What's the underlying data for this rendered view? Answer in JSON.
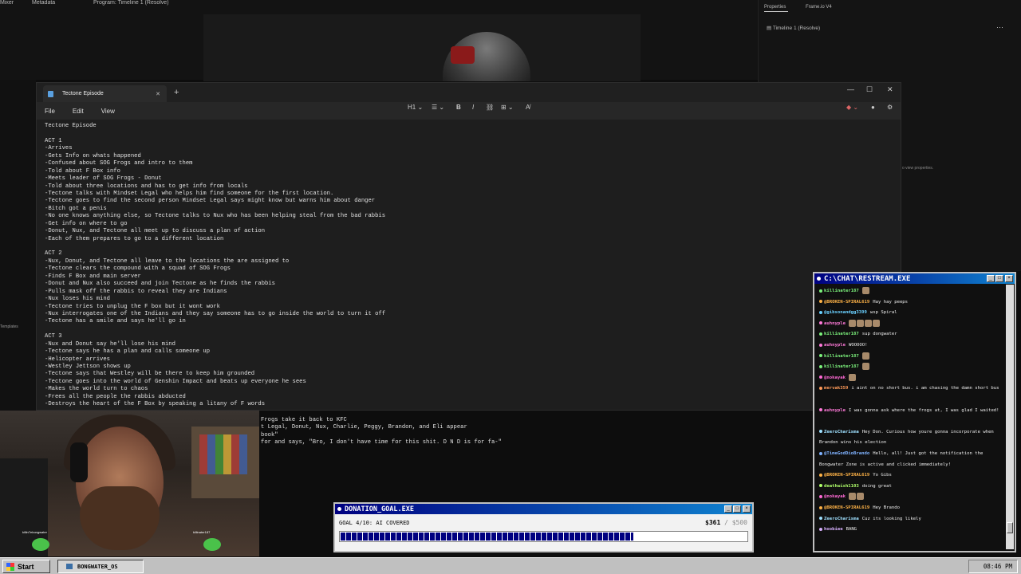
{
  "background_editor": {
    "tabs": [
      "Mixer",
      "Metadata",
      "Program: Timeline 1 (Resolve)"
    ],
    "right_panel_tabs": [
      "Properties",
      "Frame.io V4"
    ],
    "right_panel_item": "Timeline 1 (Resolve)",
    "hint": "o view properties.",
    "left_label": "Templates"
  },
  "notepad": {
    "tab_title": "Tectone Episode",
    "menu": [
      "File",
      "Edit",
      "View"
    ],
    "toolbar": [
      "H1",
      "list-icon",
      "bold-icon",
      "italic-icon",
      "link-icon",
      "table-icon",
      "clear-format-icon"
    ],
    "lines": [
      "Tectone Episode",
      "",
      "ACT 1",
      "-Arrives",
      "-Gets Info on whats happened",
      "-Confused about SOG Frogs and intro to them",
      "-Told about F Box info",
      "-Meets leader of SOG Frogs - Donut",
      "-Told about three locations and has to get info from locals",
      "-Tectone talks with Mindset Legal who helps him find someone for the first location.",
      "-Tectone goes to find the second person Mindset Legal says might know but warns him about danger",
      "-Bitch got a penis",
      "-No one knows anything else, so Tectone talks to Nux who has been helping steal from the bad rabbis",
      "-Get info on where to go",
      "-Donut, Nux, and Tectone all meet up to discuss a plan of action",
      "-Each of them prepares to go to a different location",
      "",
      "ACT 2",
      "-Nux, Donut, and Tectone all leave to the locations the are assigned to",
      "-Tectone clears the compound with a squad of SOG Frogs",
      "-Finds F Box and main server",
      "-Donut and Nux also succeed and join Tectone as he finds the rabbis",
      "-Pulls mask off the rabbis to reveal they are Indians",
      "-Nux loses his mind",
      "-Tectone tries to unplug the F box but it wont work",
      "-Nux interrogates one of the Indians and they say someone has to go inside the world to turn it off",
      "-Tectone has a smile and says he'll go in",
      "",
      "ACT 3",
      "-Nux and Donut say he'll lose his mind",
      "-Tectone says he has a plan and calls someone up",
      "-Helicopter arrives",
      "-Westley Jettson shows up",
      "-Tectone says that Westley will be there to keep him grounded",
      "-Tectone goes into the world of Genshin Impact and beats up everyone he sees",
      "-Makes the world turn to chaos",
      "-Frees all the people the rabbis abducted",
      "-Destroys the heart of the F Box by speaking a litany of F words"
    ],
    "continuation_lines": [
      "Frogs take it back to KFC",
      "t Legal, Donut, Nux, Charlie, Peggy, Brandon, and Eli appear",
      "book\"",
      "for and says, \"Bro, I don't have time for this shit. D N D is for fa-\""
    ]
  },
  "webcam": {
    "frog_labels": [
      "killin7ebongwater",
      "killinater187"
    ]
  },
  "chat": {
    "title": "C:\\CHAT\\RESTREAM.EXE",
    "messages": [
      {
        "user": "killinater187",
        "text": "",
        "color": "#7cf27c",
        "emotes": 1
      },
      {
        "user": "@BROKEN-SPIRAL619",
        "text": "Hay hay peeps",
        "color": "#ffb347",
        "emotes": 0
      },
      {
        "user": "@gibsonandgg3399",
        "text": "wsp Spiral",
        "color": "#6ad0ff",
        "emotes": 0
      },
      {
        "user": "auhnyple",
        "text": "",
        "color": "#ff7ad9",
        "emotes": 4
      },
      {
        "user": "killinater187",
        "text": "sup dongwater",
        "color": "#7cf27c",
        "emotes": 0
      },
      {
        "user": "auhnyple",
        "text": "WOOOOO!",
        "color": "#ff7ad9",
        "emotes": 0
      },
      {
        "user": "killinater187",
        "text": "",
        "color": "#7cf27c",
        "emotes": 1
      },
      {
        "user": "killinater187",
        "text": "",
        "color": "#7cf27c",
        "emotes": 1
      },
      {
        "user": "@nokayak",
        "text": "",
        "color": "#ff6ad5",
        "emotes": 1
      },
      {
        "user": "mervak359",
        "text": "i aint on no short bus. i am chasing the damn short bus",
        "color": "#ff9b5a",
        "emotes": 0,
        "wrap": true
      },
      {
        "user": "auhnyple",
        "text": "I was gonna ask where the frogs at, I was glad I waited!",
        "color": "#ff7ad9",
        "emotes": 0,
        "wrap": true
      },
      {
        "user": "ZeeroCharisma",
        "text": "Hey Don. Curious how youre gonna incorporate when Brandon wins his election",
        "color": "#9fe0ff",
        "emotes": 0,
        "wrap": true
      },
      {
        "user": "@TimeGodDioBrando",
        "text": "Hello, all! Just got the notification the Bongwater Zone is active and clicked immediately!",
        "color": "#7fb2ff",
        "emotes": 0,
        "wrap": true
      },
      {
        "user": "@BROKEN-SPIRAL619",
        "text": "Yo Gibs",
        "color": "#ffb347",
        "emotes": 0
      },
      {
        "user": "deathwish1103",
        "text": "doing great",
        "color": "#b0ff6a",
        "emotes": 0
      },
      {
        "user": "@nokayak",
        "text": "",
        "color": "#ff6ad5",
        "emotes": 2
      },
      {
        "user": "@BROKEN-SPIRAL619",
        "text": "Hey Brando",
        "color": "#ffb347",
        "emotes": 0
      },
      {
        "user": "ZeeroCharisma",
        "text": "Cuz its looking likely",
        "color": "#9fe0ff",
        "emotes": 0
      },
      {
        "user": "hoobiee",
        "text": "BANG",
        "color": "#d7b0ff",
        "emotes": 0
      }
    ]
  },
  "donation": {
    "title": "DONATION_GOAL.EXE",
    "goal_text": "GOAL 4/10: AI COVERED",
    "current": "$361",
    "separator": " / ",
    "max": "$500",
    "progress": 0.722
  },
  "taskbar": {
    "start_label": "Start",
    "task_label": "BONGWATER_OS",
    "clock": "08:46 PM"
  }
}
